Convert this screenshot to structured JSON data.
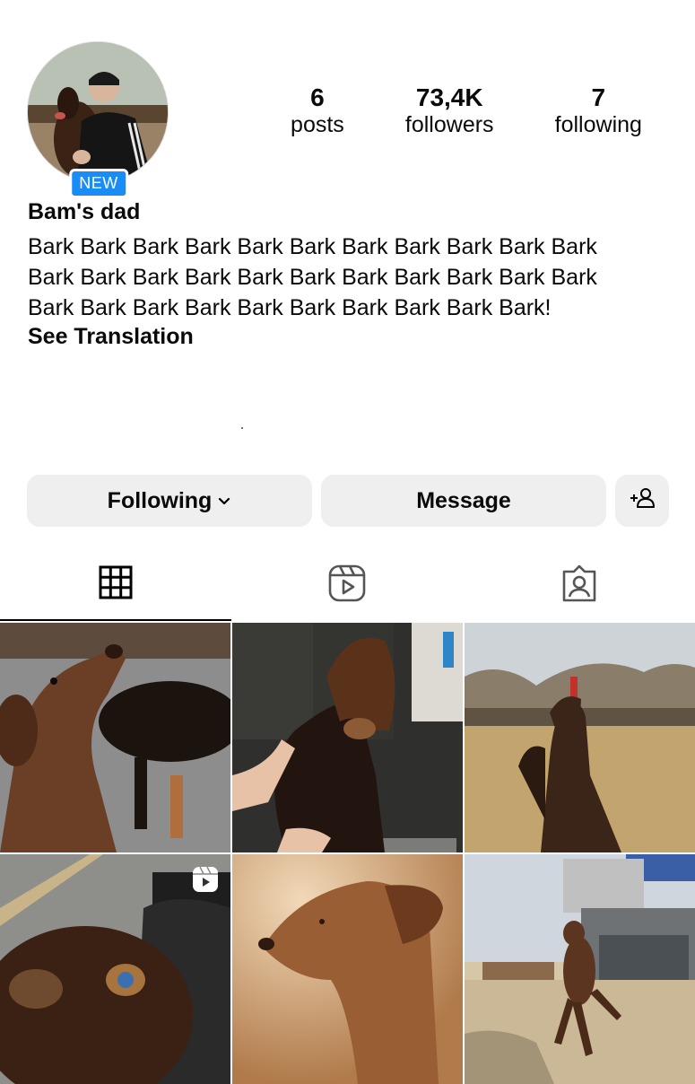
{
  "profile": {
    "avatar_badge": "NEW",
    "name": "Bam's dad",
    "bio": "Bark Bark Bark Bark Bark Bark Bark Bark Bark Bark Bark Bark Bark Bark Bark Bark Bark Bark Bark Bark Bark Bark Bark Bark Bark Bark Bark Bark Bark Bark Bark Bark!",
    "see_translation": "See Translation"
  },
  "stats": [
    {
      "value": "6",
      "label": "posts"
    },
    {
      "value": "73,4K",
      "label": "followers"
    },
    {
      "value": "7",
      "label": "following"
    }
  ],
  "actions": {
    "following_label": "Following",
    "message_label": "Message",
    "add_user_icon": "person-add-icon"
  },
  "tabs": [
    {
      "icon": "grid-icon",
      "active": true
    },
    {
      "icon": "reels-icon",
      "active": false
    },
    {
      "icon": "tagged-icon",
      "active": false
    }
  ],
  "posts": [
    {
      "description": "dog-looking-up",
      "reel": false
    },
    {
      "description": "dog-in-shower",
      "reel": false
    },
    {
      "description": "dog-on-grass",
      "reel": false
    },
    {
      "description": "dog-closeup-nose",
      "reel": true
    },
    {
      "description": "dog-profile-portrait",
      "reel": false
    },
    {
      "description": "dog-jumping",
      "reel": false
    }
  ],
  "colors": {
    "badge": "#1a8cf5",
    "button_bg": "#efefef",
    "text": "#0a0a0a"
  }
}
